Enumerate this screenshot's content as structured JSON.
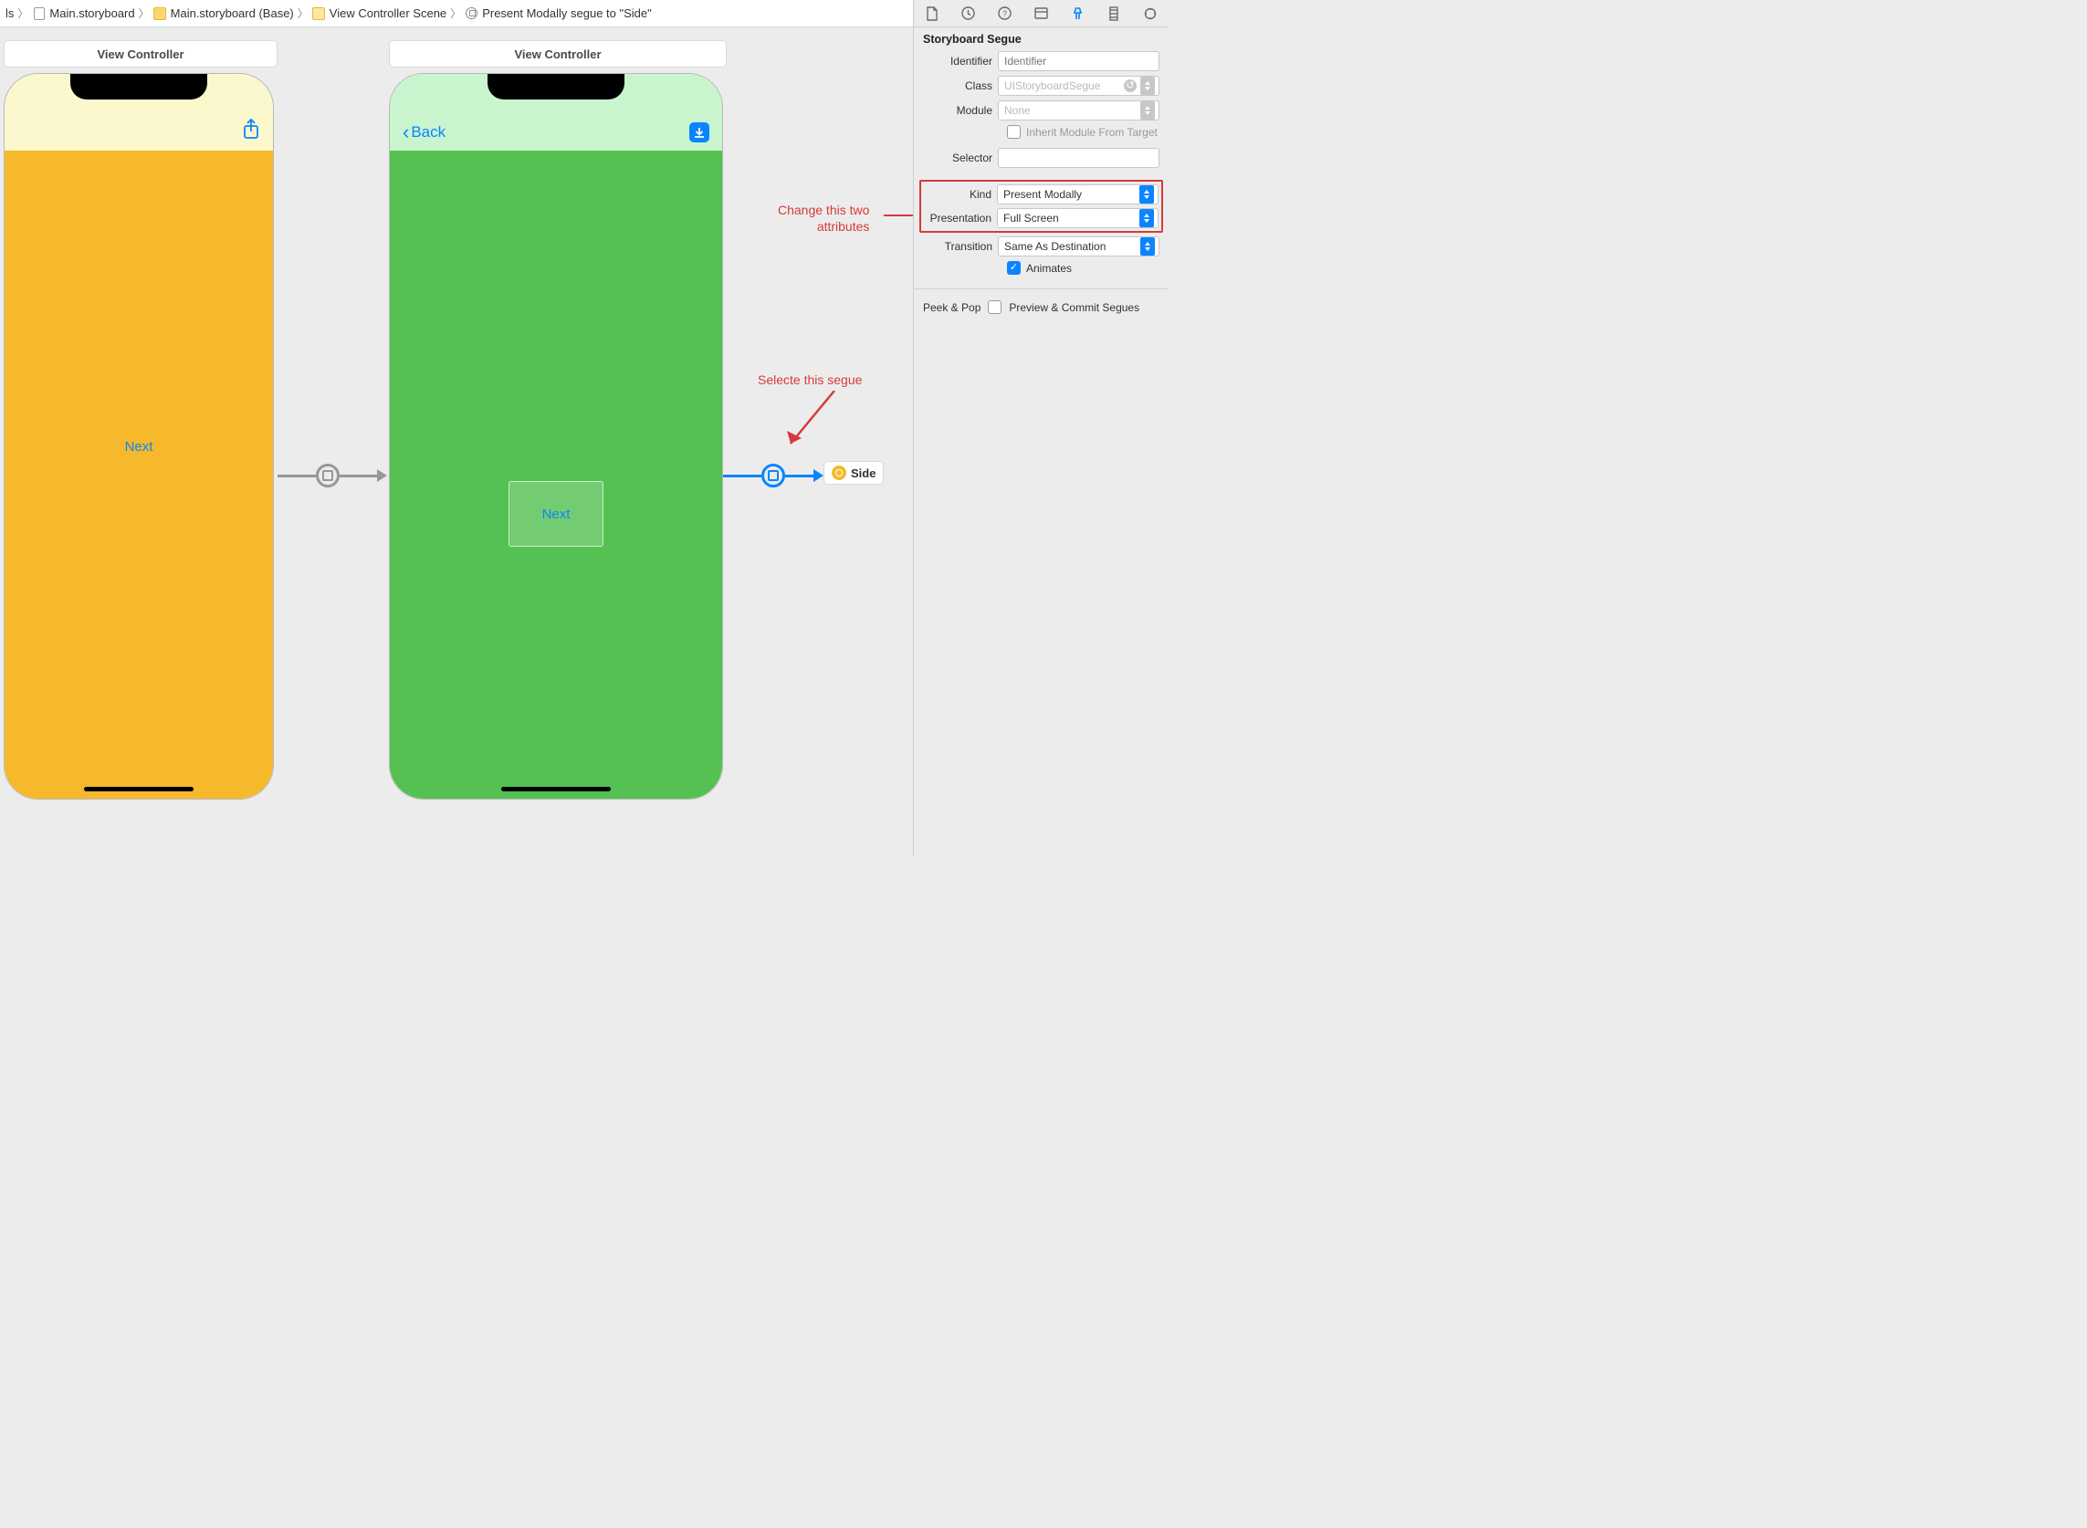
{
  "breadcrumb": {
    "part0_suffix": "ls",
    "part1": "Main.storyboard",
    "part2": "Main.storyboard (Base)",
    "part3": "View Controller Scene",
    "part4": "Present Modally segue to \"Side\""
  },
  "canvas": {
    "vc1_title": "View Controller",
    "vc2_title": "View Controller",
    "vc1_next": "Next",
    "vc2_back": "Back",
    "vc2_next": "Next",
    "side_ref": "Side"
  },
  "annotations": {
    "attr_line1": "Change this two",
    "attr_line2": "attributes",
    "segue": "Selecte this segue"
  },
  "inspector": {
    "section": "Storyboard Segue",
    "identifier_label": "Identifier",
    "identifier_placeholder": "Identifier",
    "class_label": "Class",
    "class_value": "UIStoryboardSegue",
    "module_label": "Module",
    "module_value": "None",
    "inherit_label": "Inherit Module From Target",
    "selector_label": "Selector",
    "kind_label": "Kind",
    "kind_value": "Present Modally",
    "presentation_label": "Presentation",
    "presentation_value": "Full Screen",
    "transition_label": "Transition",
    "transition_value": "Same As Destination",
    "animates_label": "Animates",
    "peek_label": "Peek & Pop",
    "peek_value": "Preview & Commit Segues"
  }
}
